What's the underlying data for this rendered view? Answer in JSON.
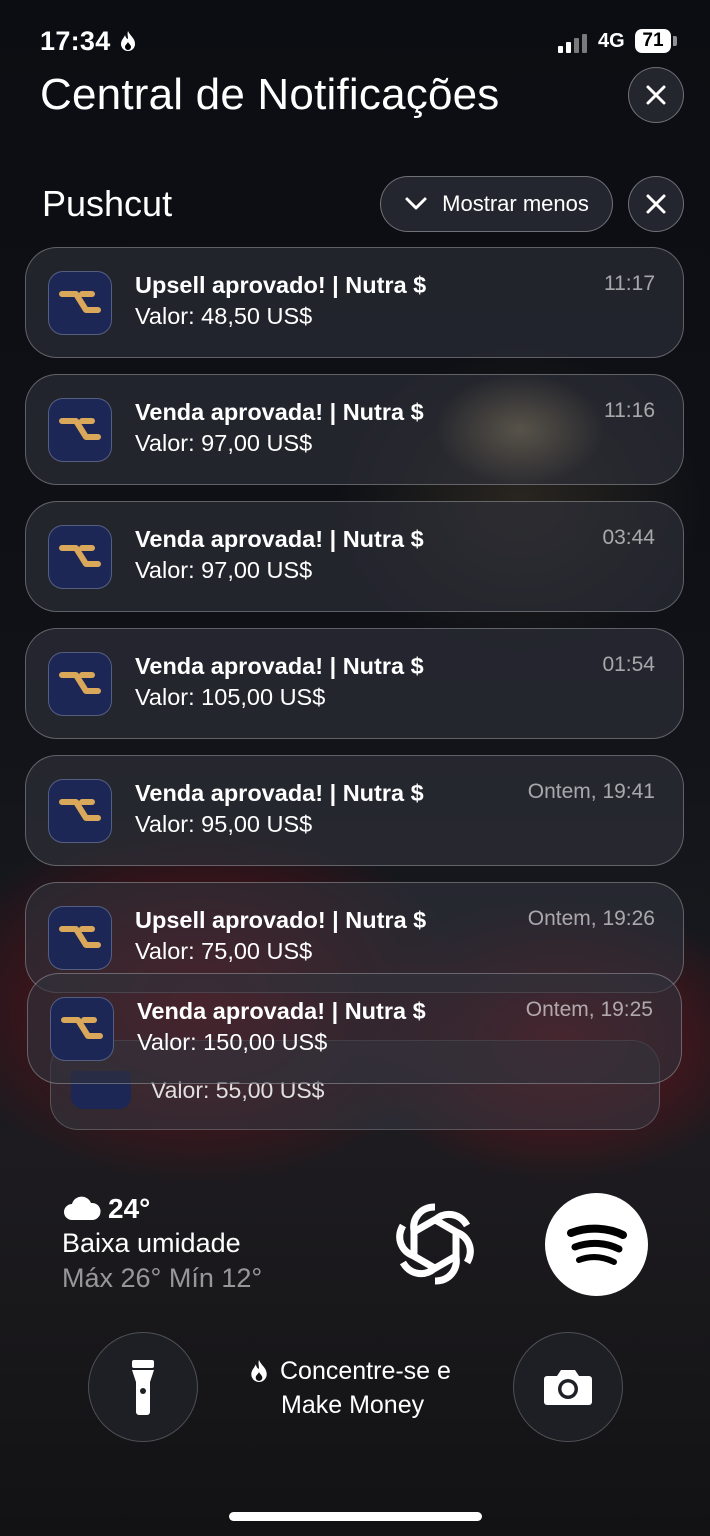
{
  "status_bar": {
    "time": "17:34",
    "focus_icon": "flame-icon",
    "network": "4G",
    "battery": "71"
  },
  "notification_center": {
    "title": "Central de Notificações",
    "close_icon": "close-icon"
  },
  "group": {
    "app_name": "Pushcut",
    "show_less_label": "Mostrar menos"
  },
  "notifications": [
    {
      "title": "Upsell aprovado! | Nutra $",
      "body": "Valor: 48,50 US$",
      "time": "11:17"
    },
    {
      "title": "Venda aprovada! | Nutra $",
      "body": "Valor: 97,00 US$",
      "time": "11:16"
    },
    {
      "title": "Venda aprovada! | Nutra $",
      "body": "Valor: 97,00 US$",
      "time": "03:44"
    },
    {
      "title": "Venda aprovada! | Nutra $",
      "body": "Valor: 105,00 US$",
      "time": "01:54"
    },
    {
      "title": "Venda aprovada! | Nutra $",
      "body": "Valor: 95,00 US$",
      "time": "Ontem, 19:41"
    },
    {
      "title": "Upsell aprovado! | Nutra $",
      "body": "Valor: 75,00 US$",
      "time": "Ontem, 19:26"
    },
    {
      "title": "Venda aprovada! | Nutra $",
      "body": "Valor: 150,00 US$",
      "time": "Ontem, 19:25"
    }
  ],
  "stacked_notification": {
    "body": "Valor: 55,00 US$"
  },
  "weather": {
    "icon": "cloud-icon",
    "temperature": "24°",
    "condition": "Baixa umidade",
    "range": "Máx 26° Mín 12°"
  },
  "widgets": {
    "chatgpt_icon": "chatgpt-icon",
    "spotify_icon": "spotify-icon",
    "spotify_color": "#000000"
  },
  "focus": {
    "icon": "flame-icon",
    "line1": "Concentre-se e",
    "line2": "Make Money"
  },
  "controls": {
    "flashlight_icon": "flashlight-icon",
    "camera_icon": "camera-icon"
  },
  "colors": {
    "app_icon_bg": "#1c2756",
    "app_icon_accent": "#d9a85a"
  }
}
